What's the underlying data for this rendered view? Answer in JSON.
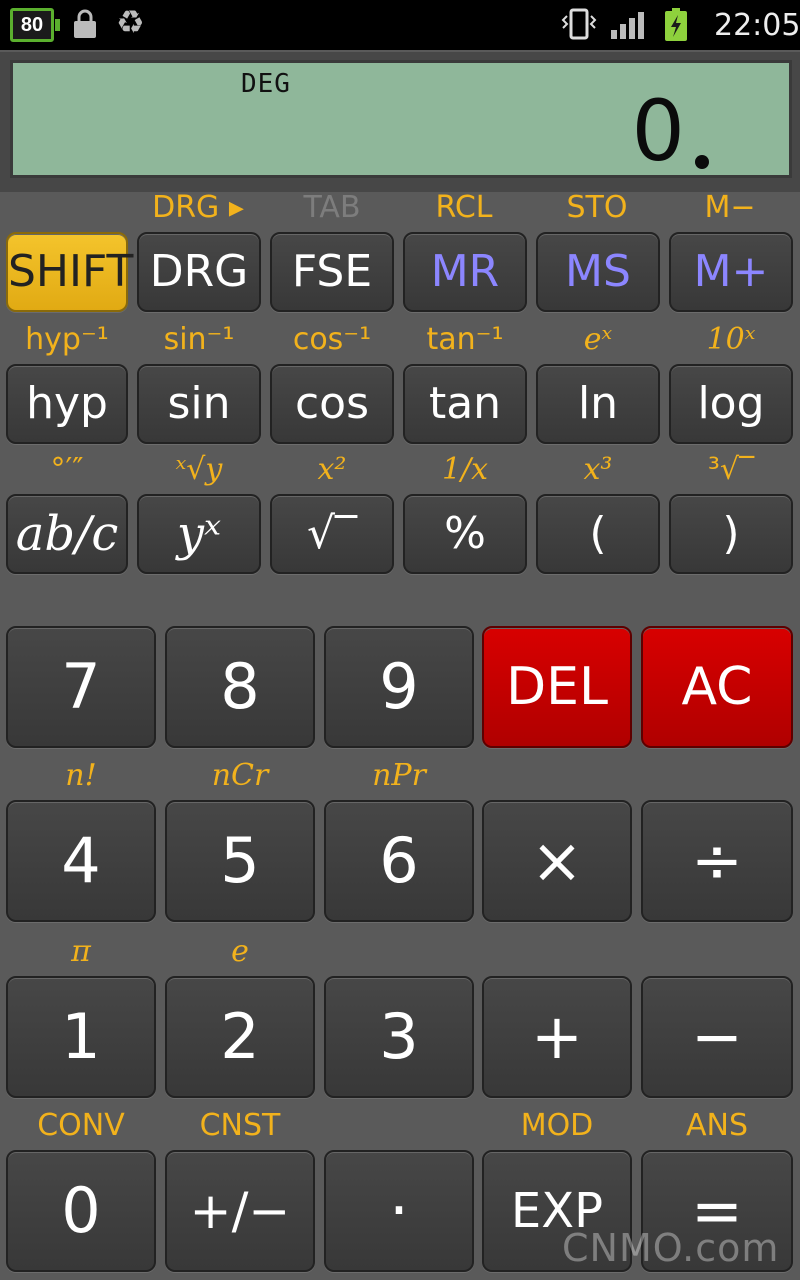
{
  "status_bar": {
    "battery_level": "80",
    "time": "22:05",
    "icons": [
      "battery-icon",
      "lock-icon",
      "recycle-icon",
      "vibrate-icon",
      "signal-icon",
      "charging-icon"
    ]
  },
  "display": {
    "mode": "DEG",
    "value": "0"
  },
  "row1": {
    "secondary": [
      "DRG ▸",
      "TAB",
      "RCL",
      "STO",
      "M−"
    ],
    "keys": [
      "SHIFT",
      "DRG",
      "FSE",
      "MR",
      "MS",
      "M+"
    ]
  },
  "row2": {
    "secondary": [
      "hyp⁻¹",
      "sin⁻¹",
      "cos⁻¹",
      "tan⁻¹",
      "eˣ",
      "10ˣ"
    ],
    "keys": [
      "hyp",
      "sin",
      "cos",
      "tan",
      "ln",
      "log"
    ]
  },
  "row3": {
    "secondary": [
      "°′″",
      "ˣ√y",
      "x²",
      "1/x",
      "x³",
      "³√‾"
    ],
    "keys": [
      "ab/c",
      "yˣ",
      "√‾",
      "%",
      "(",
      ")"
    ]
  },
  "row4": {
    "secondary": [],
    "keys": [
      "7",
      "8",
      "9",
      "DEL",
      "AC"
    ]
  },
  "row5": {
    "secondary": [
      "n!",
      "nCr",
      "nPr"
    ],
    "keys": [
      "4",
      "5",
      "6",
      "×",
      "÷"
    ]
  },
  "row6": {
    "secondary": [
      "π",
      "e"
    ],
    "keys": [
      "1",
      "2",
      "3",
      "+",
      "−"
    ]
  },
  "row7": {
    "secondary": [
      "CONV",
      "CNST",
      "MOD",
      "ANS"
    ],
    "keys": [
      "0",
      "+/−",
      "·",
      "EXP",
      "="
    ]
  },
  "watermark": "CNMO.com",
  "colors": {
    "shift": "#f4c42c",
    "red_key": "#d00000",
    "memory_text": "#8c86ff",
    "secondary_text": "#f2b21c",
    "lcd": "#8fb79a"
  }
}
